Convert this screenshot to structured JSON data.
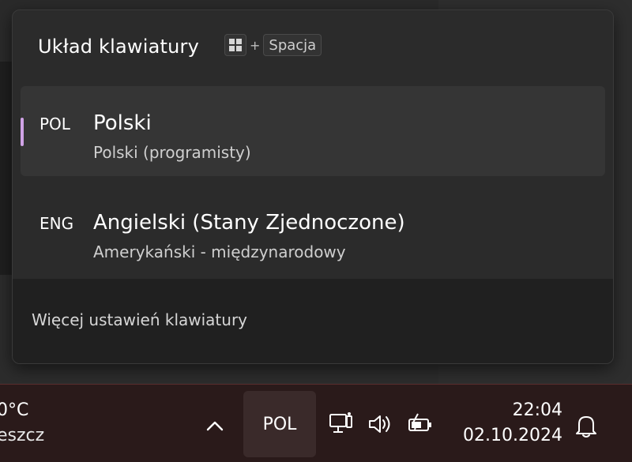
{
  "flyout": {
    "title": "Układ klawiatury",
    "shortcut": {
      "plus": "+",
      "space_key": "Spacja"
    },
    "languages": [
      {
        "code": "POL",
        "name": "Polski",
        "layout": "Polski (programisty)",
        "selected": true
      },
      {
        "code": "ENG",
        "name": "Angielski (Stany Zjednoczone)",
        "layout": "Amerykański - międzynarodowy",
        "selected": false
      }
    ],
    "footer_link": "Więcej ustawień klawiatury"
  },
  "taskbar": {
    "weather": {
      "temperature": "0°C",
      "description": "eszcz"
    },
    "language_indicator": "POL",
    "clock": {
      "time": "22:04",
      "date": "02.10.2024"
    },
    "tray_icons": [
      "show-hidden-icons-chevron",
      "network-icon",
      "volume-icon",
      "battery-icon",
      "notification-bell-icon"
    ]
  },
  "colors": {
    "accent": "#d0a3e6",
    "flyout_bg": "#2b2b2b",
    "taskbar_bg": "#2a1a1a"
  }
}
